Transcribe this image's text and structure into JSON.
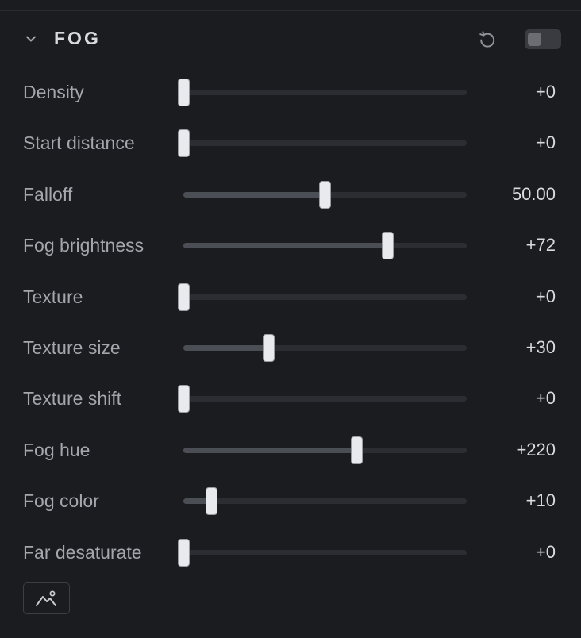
{
  "panel": {
    "title": "FOG",
    "enabled": false
  },
  "icons": {
    "collapse": "chevron-down-icon",
    "reset": "reset-icon",
    "footer": "mountain-landscape-icon"
  },
  "colors": {
    "background": "#1b1c20",
    "track": "#2c2d32",
    "fill": "#4c4e55",
    "thumb": "#e8eaee",
    "label": "#a4a6ab",
    "value": "#d9dadd"
  },
  "sliders": [
    {
      "label": "Density",
      "value": "+0",
      "fraction": 0.0
    },
    {
      "label": "Start distance",
      "value": "+0",
      "fraction": 0.0
    },
    {
      "label": "Falloff",
      "value": "50.00",
      "fraction": 0.5
    },
    {
      "label": "Fog brightness",
      "value": "+72",
      "fraction": 0.72
    },
    {
      "label": "Texture",
      "value": "+0",
      "fraction": 0.0
    },
    {
      "label": "Texture size",
      "value": "+30",
      "fraction": 0.3
    },
    {
      "label": "Texture shift",
      "value": "+0",
      "fraction": 0.0
    },
    {
      "label": "Fog hue",
      "value": "+220",
      "fraction": 0.611
    },
    {
      "label": "Fog color",
      "value": "+10",
      "fraction": 0.1
    },
    {
      "label": "Far desaturate",
      "value": "+0",
      "fraction": 0.0
    }
  ]
}
